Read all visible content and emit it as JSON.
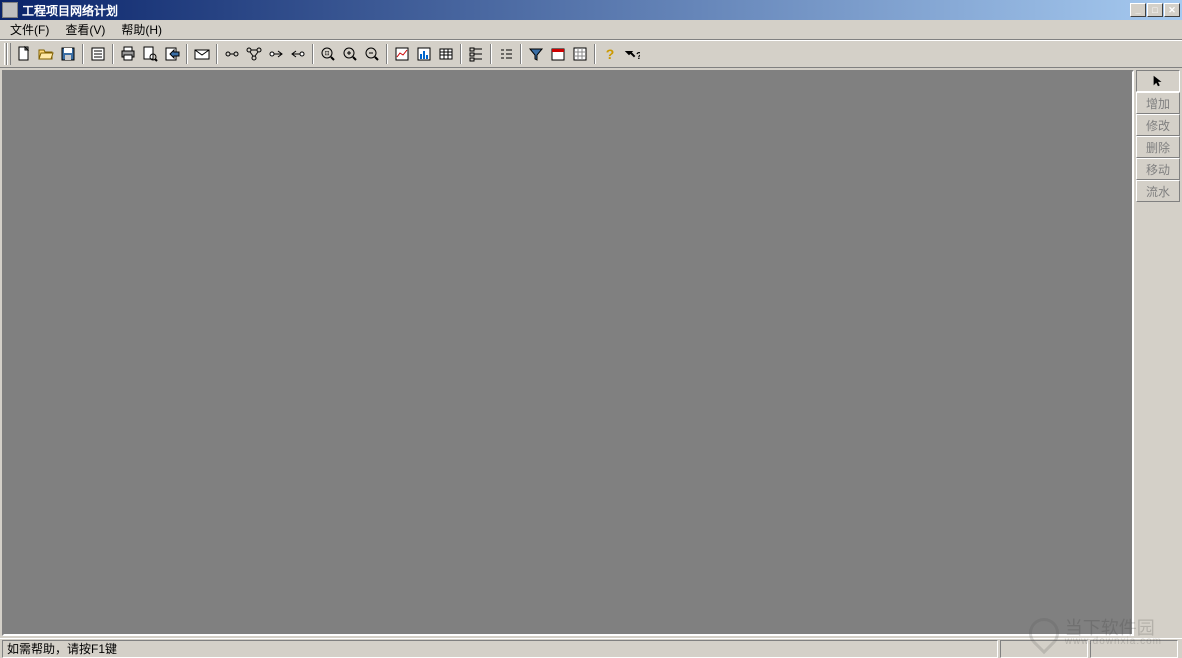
{
  "window": {
    "title": "工程项目网络计划"
  },
  "menu": {
    "file": "文件(F)",
    "view": "查看(V)",
    "help": "帮助(H)"
  },
  "right_panel": {
    "pointer": "↖",
    "add": "增加",
    "modify": "修改",
    "delete": "删除",
    "move": "移动",
    "flow": "流水"
  },
  "status": {
    "help_text": "如需帮助，请按F1键"
  },
  "watermark": {
    "text": "当下软件园",
    "url": "www.downxia.com"
  }
}
